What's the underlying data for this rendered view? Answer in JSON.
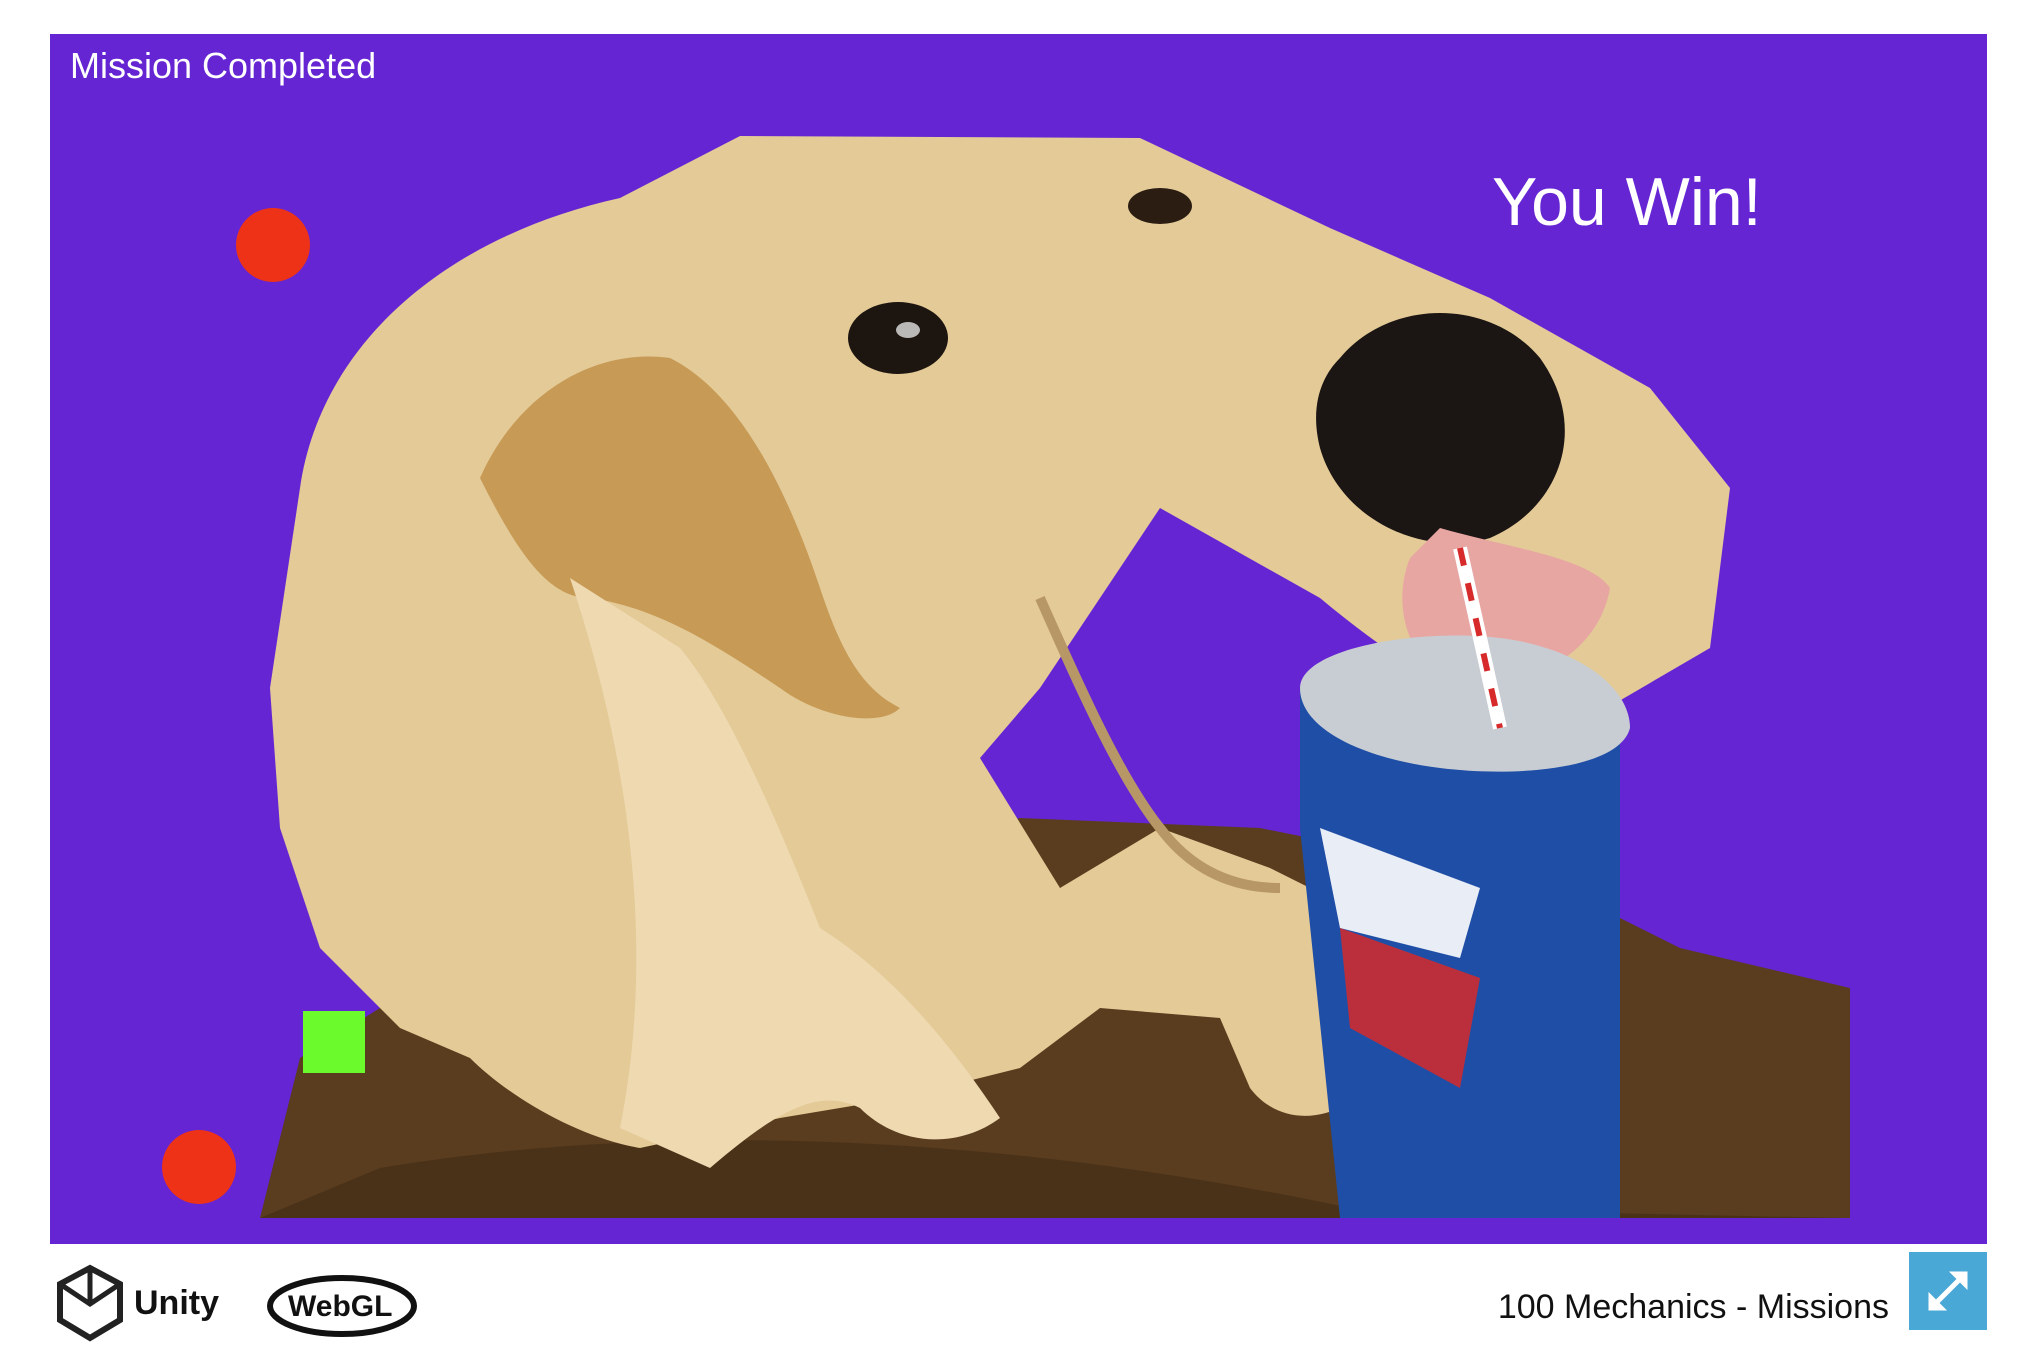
{
  "game": {
    "status_text": "Mission Completed",
    "win_text": "You Win!",
    "background_color": "#6525D3",
    "objects": [
      {
        "type": "circle",
        "color": "#EE3218",
        "role": "enemy"
      },
      {
        "type": "circle",
        "color": "#EE3218",
        "role": "enemy"
      },
      {
        "type": "square",
        "color": "#6BFB2C",
        "role": "player"
      }
    ],
    "picture_icon": "dog-drinking-soda-picture"
  },
  "footer": {
    "logo_text": "Unity",
    "logo_secondary_text": "WebGL",
    "title": "100 Mechanics - Missions",
    "fullscreen_icon": "fullscreen-icon",
    "fullscreen_color": "#4AA8D6"
  }
}
